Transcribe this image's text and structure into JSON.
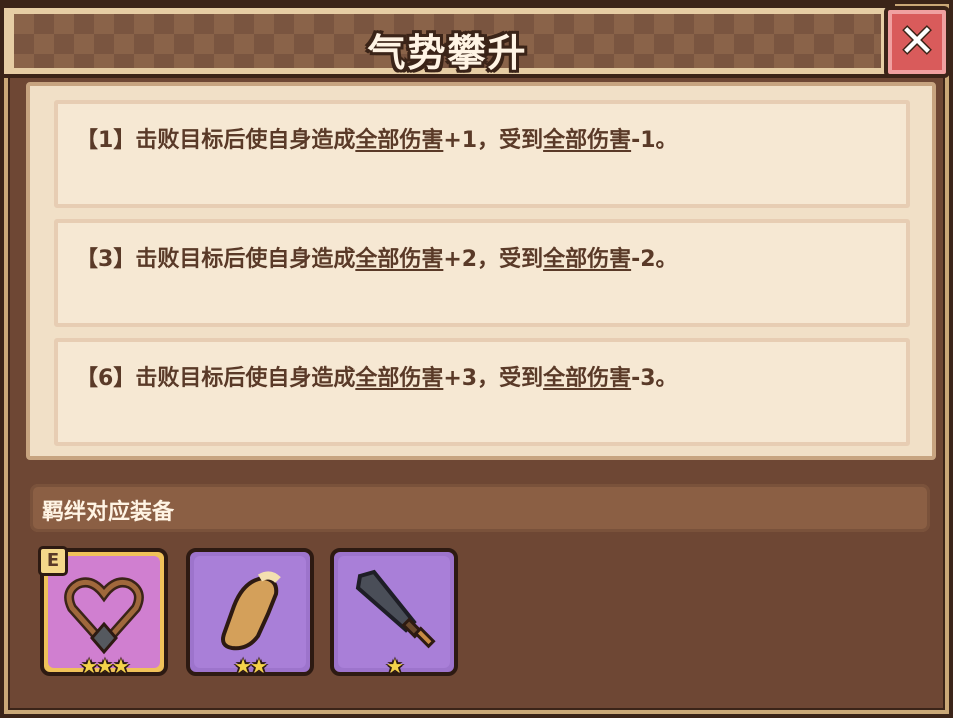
{
  "header": {
    "title": "气势攀升",
    "close_icon": "close-x-icon"
  },
  "effects": [
    {
      "tier": "【1】",
      "prefix": "击败目标后使自身造成",
      "stat1": "全部伤害",
      "mid": "+1，受到",
      "stat2": "全部伤害",
      "suffix": "-1。"
    },
    {
      "tier": "【3】",
      "prefix": "击败目标后使自身造成",
      "stat1": "全部伤害",
      "mid": "+2，受到",
      "stat2": "全部伤害",
      "suffix": "-2。"
    },
    {
      "tier": "【6】",
      "prefix": "击败目标后使自身造成",
      "stat1": "全部伤害",
      "mid": "+3，受到",
      "stat2": "全部伤害",
      "suffix": "-3。"
    }
  ],
  "equipment": {
    "label": "羁绊对应装备",
    "items": [
      {
        "icon": "heart-necklace-icon",
        "stars": "★★★",
        "star_count": 3,
        "badge": "E",
        "bg": "#d07fd0"
      },
      {
        "icon": "leather-glove-icon",
        "stars": "★★",
        "star_count": 2,
        "bg": "#a97fd8"
      },
      {
        "icon": "iron-sword-icon",
        "stars": "★",
        "star_count": 1,
        "bg": "#a97fd8"
      }
    ]
  },
  "colors": {
    "frame": "#6e4734",
    "panel": "#f1e0c7",
    "text": "#5a3a28",
    "close": "#d95b5b"
  }
}
